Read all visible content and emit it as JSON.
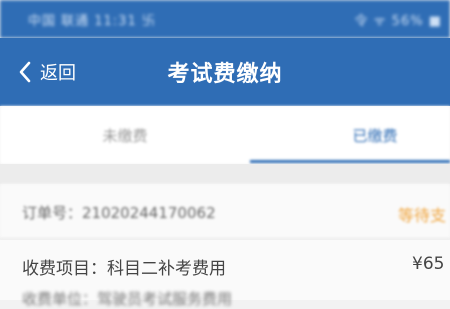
{
  "status_bar": {
    "left": "中国 联通 11:31 卐",
    "right": "令 ᯤ 56% ■"
  },
  "nav": {
    "back_label": "返回",
    "title": "考试费缴纳"
  },
  "tabs": [
    {
      "label": "未缴费"
    },
    {
      "label": "已缴费"
    }
  ],
  "order": {
    "label": "订单号：21020244170062",
    "status": "等待支"
  },
  "item": {
    "label": "收费项目：科目二补考费用",
    "price": "¥65",
    "sub": "收费单位：驾驶员考试服务费用"
  },
  "colors": {
    "primary": "#2f6db5",
    "status": "#f0a640"
  }
}
